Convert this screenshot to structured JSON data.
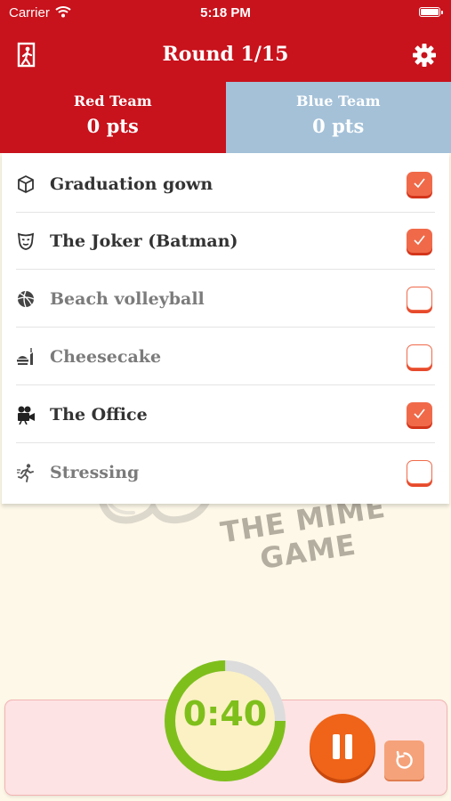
{
  "status_bar": {
    "carrier": "Carrier",
    "time": "5:18 PM"
  },
  "header": {
    "title": "Round 1/15",
    "left_icon": "exit-icon",
    "right_icon": "gear-icon"
  },
  "teams": [
    {
      "name": "Red Team",
      "score": "0 pts",
      "color": "#c8121c"
    },
    {
      "name": "Blue Team",
      "score": "0 pts",
      "color": "#a4c1d8"
    }
  ],
  "words": [
    {
      "text": "Graduation gown",
      "icon": "box-icon",
      "checked": true
    },
    {
      "text": "The Joker (Batman)",
      "icon": "mask-icon",
      "checked": true
    },
    {
      "text": "Beach volleyball",
      "icon": "ball-icon",
      "checked": false
    },
    {
      "text": "Cheesecake",
      "icon": "food-icon",
      "checked": false
    },
    {
      "text": "The Office",
      "icon": "movie-camera-icon",
      "checked": true
    },
    {
      "text": "Stressing",
      "icon": "running-person-icon",
      "checked": false
    }
  ],
  "background_logo": {
    "line1": "THE MIME",
    "line2": "GAME"
  },
  "timer": {
    "display": "0:40",
    "remaining_fraction": 0.75
  },
  "controls": {
    "pause_icon": "pause-icon",
    "reset_icon": "reset-icon"
  },
  "colors": {
    "header_red": "#c8121c",
    "blue_team": "#a4c1d8",
    "checkbox_orange": "#f06a4a",
    "timer_green": "#7fbf1c",
    "pause_orange": "#ef6418"
  }
}
